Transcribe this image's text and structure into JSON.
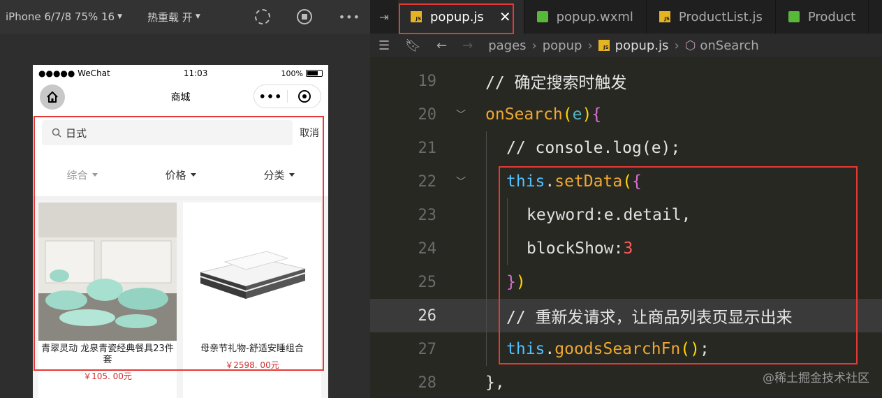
{
  "simulator": {
    "device": "iPhone 6/7/8 75% 16",
    "hot_reload": "热重载 开",
    "status": {
      "carrier": "●●●●● WeChat",
      "time": "11:03",
      "battery": "100%"
    },
    "nav_title": "商城",
    "search": {
      "value": "日式",
      "cancel": "取消"
    },
    "filters": [
      "综合",
      "价格",
      "分类"
    ],
    "products": [
      {
        "name": "青翠灵动 龙泉青瓷经典餐具23件套",
        "price": "￥105. 00元"
      },
      {
        "name": "母亲节礼物-舒适安睡组合",
        "price": "￥2598. 00元"
      }
    ]
  },
  "editor": {
    "tabs": [
      {
        "label": "popup.js",
        "type": "js",
        "active": true
      },
      {
        "label": "popup.wxml",
        "type": "wxml",
        "active": false
      },
      {
        "label": "ProductList.js",
        "type": "js",
        "active": false
      },
      {
        "label": "Product",
        "type": "wxml",
        "active": false
      }
    ],
    "breadcrumb": [
      "pages",
      "popup",
      "popup.js",
      "onSearch"
    ],
    "line_numbers": [
      "19",
      "20",
      "21",
      "22",
      "23",
      "24",
      "25",
      "26",
      "27",
      "28"
    ],
    "code": {
      "l19": "// 确定搜索时触发",
      "l20_fn": "onSearch",
      "l20_param": "e",
      "l21": "// console.log(e);",
      "l22_this": "this",
      "l22_method": "setData",
      "l23_key": "keyword",
      "l23_val": "e.detail,",
      "l24_key": "blockShow",
      "l24_val": "3",
      "l26": "// 重新发请求，让商品列表页显示出来",
      "l27_this": "this",
      "l27_method": "goodsSearchFn",
      "l28": "},"
    },
    "watermark": "@稀土掘金技术社区"
  }
}
